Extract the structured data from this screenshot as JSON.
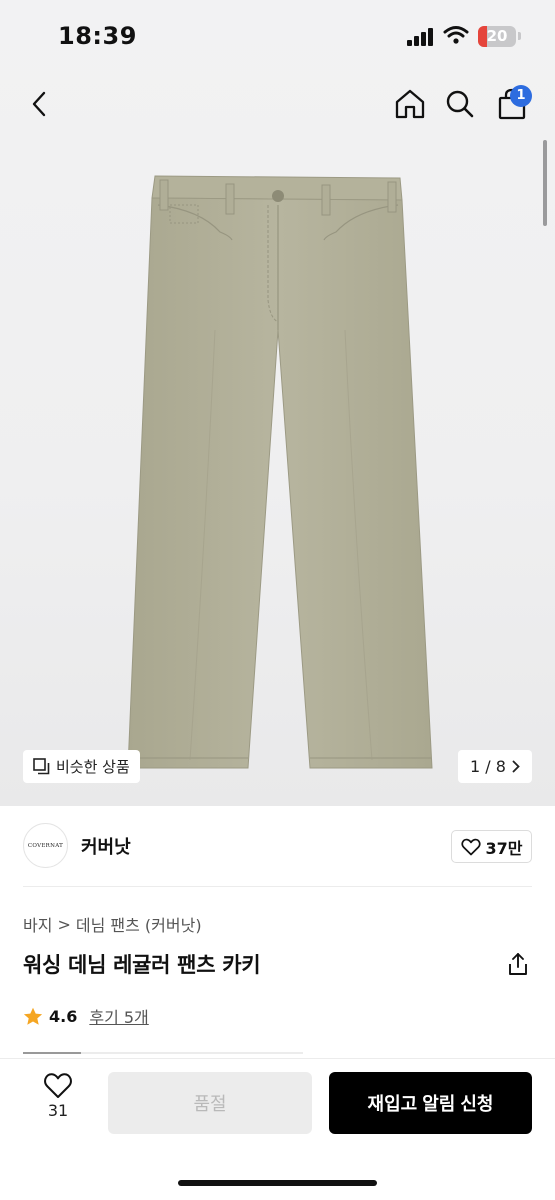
{
  "status_bar": {
    "time": "18:39",
    "battery_level": "20",
    "battery_color": "#e5453b",
    "icons": [
      "signal-icon",
      "wifi-icon",
      "battery-icon"
    ]
  },
  "nav": {
    "icons": [
      "back-arrow-icon",
      "home-icon",
      "search-icon",
      "shopping-bag-icon"
    ],
    "cart_count": "1",
    "cart_badge_color": "#2d6cdf"
  },
  "gallery": {
    "similar_label": "비슷한 상품",
    "page_indicator": "1 / 8",
    "product_color": "#b2b09a"
  },
  "brand": {
    "logo_text": "COVERNAT",
    "name": "커버낫",
    "like_count": "37만"
  },
  "breadcrumb": {
    "category": "바지",
    "separator": ">",
    "subcategory": "데님 팬츠 (커버낫)"
  },
  "product": {
    "title": "워싱 데님 레귤러 팬츠 카키",
    "rating": "4.6",
    "review_label": "후기 5개",
    "star_color": "#f5a623"
  },
  "bottom_bar": {
    "wish_count": "31",
    "soldout_label": "품절",
    "restock_label": "재입고 알림 신청"
  }
}
